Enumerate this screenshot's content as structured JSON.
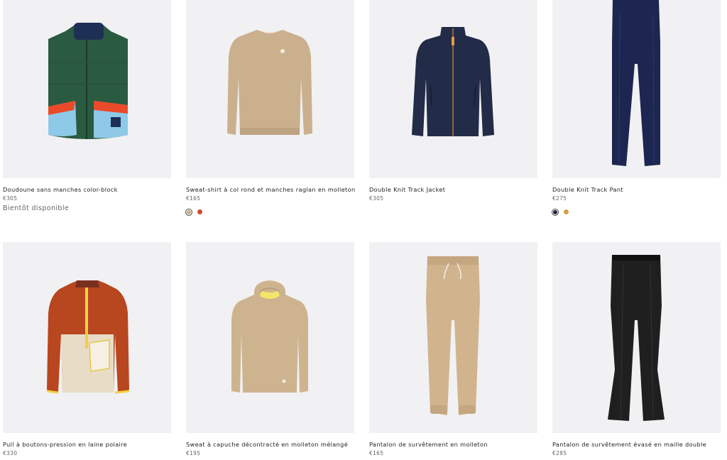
{
  "products": [
    {
      "name": "Doudoune sans manches color-block",
      "price": "€305",
      "status": "Bientôt disponible",
      "swatches": []
    },
    {
      "name": "Sweat-shirt à col rond et manches raglan en molleton",
      "price": "€165",
      "status": "",
      "swatches": [
        {
          "color": "#c7ae8d",
          "selected": true
        },
        {
          "color": "#d24a2e",
          "selected": false
        }
      ]
    },
    {
      "name": "Double Knit Track Jacket",
      "price": "€305",
      "status": "",
      "swatches": []
    },
    {
      "name": "Double Knit Track Pant",
      "price": "€275",
      "status": "",
      "swatches": [
        {
          "color": "#1e2444",
          "selected": true
        },
        {
          "color": "#d4a043",
          "selected": false
        }
      ]
    },
    {
      "name": "Pull à boutons-pression en laine polaire",
      "price": "€330",
      "status": "",
      "swatches": []
    },
    {
      "name": "Sweat à capuche décontracté en molleton mélangé",
      "price": "€195",
      "status": "",
      "swatches": []
    },
    {
      "name": "Pantalon de survêtement en molleton",
      "price": "€165",
      "status": "",
      "swatches": []
    },
    {
      "name": "Pantalon de survêtement évasé en maille double",
      "price": "€285",
      "status": "",
      "swatches": []
    }
  ]
}
